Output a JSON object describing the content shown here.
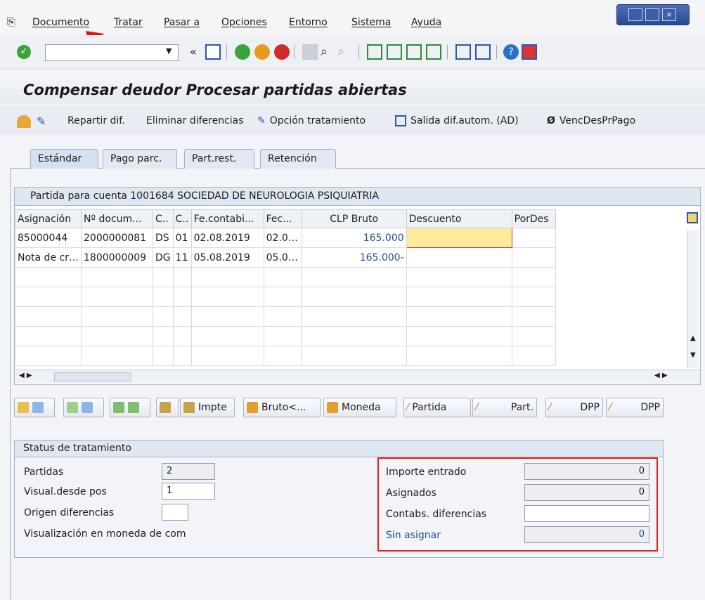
{
  "menu": [
    "Documento",
    "Tratar",
    "Pasar a",
    "Opciones",
    "Entorno",
    "Sistema",
    "Ayuda"
  ],
  "title": "Compensar deudor Procesar partidas abiertas",
  "app_toolbar": {
    "repartir": "Repartir dif.",
    "eliminar": "Eliminar diferencias",
    "opcion": "Opción tratamiento",
    "salida": "Salida dif.autom. (AD)",
    "venc": "VencDesPrPago"
  },
  "tabs": [
    "Estándar",
    "Pago parc.",
    "Part.rest.",
    "Retención"
  ],
  "grid": {
    "title": "Partida para cuenta 1001684 SOCIEDAD DE NEUROLOGIA PSIQUIATRIA",
    "columns": [
      "Asignación",
      "Nº docum...",
      "C..",
      "C..",
      "Fe.contabi...",
      "Fec...",
      "CLP Bruto",
      "Descuento",
      "PorDes"
    ],
    "rows": [
      [
        "85000044",
        "2000000081",
        "DS",
        "01",
        "02.08.2019",
        "02.0…",
        "165.000",
        "",
        ""
      ],
      [
        "Nota de cr…",
        "1800000009",
        "DG",
        "11",
        "05.08.2019",
        "05.0…",
        "165.000-",
        "",
        ""
      ]
    ]
  },
  "bottom_buttons": {
    "impte": "Impte",
    "bruto": "Bruto<...",
    "moneda": "Moneda",
    "partida": "Partida",
    "part": "Part.",
    "dpp1": "DPP",
    "dpp2": "DPP"
  },
  "status": {
    "header": "Status de tratamiento",
    "partidas_label": "Partidas",
    "partidas_value": "2",
    "visual_label": "Visual.desde pos",
    "visual_value": "1",
    "origen_label": "Origen diferencias",
    "origen_value": "",
    "visualizacion_label": "Visualización en moneda de com",
    "importe_label": "Importe entrado",
    "importe_value": "0",
    "asignados_label": "Asignados",
    "asignados_value": "0",
    "contabs_label": "Contabs. diferencias",
    "contabs_value": "",
    "sin_label": "Sin asignar",
    "sin_value": "0"
  }
}
